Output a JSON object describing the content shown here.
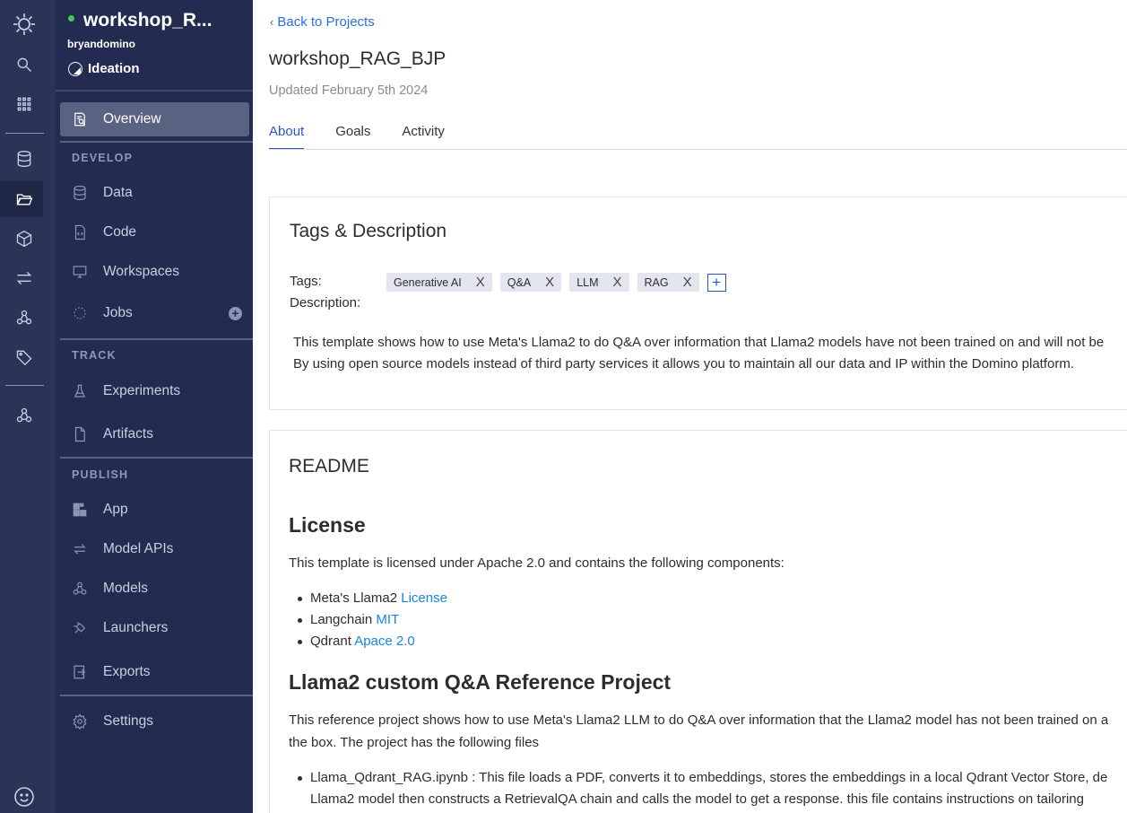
{
  "project": {
    "title": "workshop_R...",
    "owner": "bryandomino",
    "stage": "Ideation"
  },
  "nav": {
    "overview": "Overview",
    "develop_label": "DEVELOP",
    "data": "Data",
    "code": "Code",
    "workspaces": "Workspaces",
    "jobs": "Jobs",
    "track_label": "TRACK",
    "experiments": "Experiments",
    "artifacts": "Artifacts",
    "publish_label": "PUBLISH",
    "app": "App",
    "model_apis": "Model APIs",
    "models": "Models",
    "launchers": "Launchers",
    "exports": "Exports",
    "settings": "Settings"
  },
  "header": {
    "back_label": "Back to Projects",
    "page_title": "workshop_RAG_BJP",
    "updated": "Updated February 5th 2024"
  },
  "tabs": [
    "About",
    "Goals",
    "Activity"
  ],
  "tags_card": {
    "title": "Tags & Description",
    "tags_label": "Tags:",
    "description_label": "Description:",
    "tags": [
      "Generative AI",
      "Q&A",
      "LLM",
      "RAG"
    ],
    "add_symbol": "+",
    "remove_symbol": "X",
    "description_line1": "This template shows how to use Meta's Llama2 to do Q&A over information that Llama2 models have not been trained on and will not be",
    "description_line2": "By using open source models instead of third party services it allows you to maintain all our data and IP within the Domino platform."
  },
  "readme": {
    "title": "README",
    "license_heading": "License",
    "license_intro": "This template is licensed under Apache 2.0 and contains the following components:",
    "components": [
      {
        "name": "Meta's Llama2",
        "link": "License"
      },
      {
        "name": "Langchain",
        "link": "MIT"
      },
      {
        "name": "Qdrant",
        "link": "Apace 2.0"
      }
    ],
    "project_heading": "Llama2 custom Q&A Reference Project",
    "project_intro_line1": "This reference project shows how to use Meta's Llama2 LLM to do Q&A over information that the Llama2 model has not been trained on a",
    "project_intro_line2": "the box. The project has the following files",
    "file_line1": "Llama_Qdrant_RAG.ipynb : This file loads a PDF, converts it to embeddings, stores the embeddings in a local Qdrant Vector Store, de",
    "file_line2": "Llama2 model then constructs a RetrievalQA chain and calls the model to get a response. this file contains instructions on tailoring"
  },
  "colors": {
    "rail_bg": "#2b3457",
    "sidebar_bg": "#232c50",
    "active_nav_bg": "#5a6282",
    "accent": "#2a55c8",
    "link": "#1a84e0",
    "status_dot": "#3ecf4f"
  },
  "icons": {
    "rail": [
      "domino-logo-icon",
      "search-icon",
      "apps-grid-icon",
      "database-icon",
      "folder-open-icon",
      "cube-icon",
      "transfer-arrows-icon",
      "model-nodes-icon",
      "tag-icon",
      "model-nodes-icon",
      "smiley-feedback-icon"
    ],
    "nav": [
      "overview-icon",
      "database-icon",
      "code-file-icon",
      "monitor-icon",
      "spinner-jobs-icon",
      "flask-icon",
      "file-icon",
      "app-grid-icon",
      "transfer-arrows-icon",
      "model-nodes-icon",
      "launcher-icon",
      "export-icon",
      "gear-icon"
    ]
  }
}
